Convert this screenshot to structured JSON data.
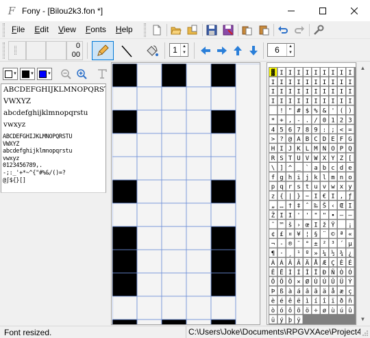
{
  "window": {
    "title": "Fony - [Bilou2k3.fon *]",
    "app_icon": "fony-f-icon"
  },
  "menu": [
    {
      "label": "File",
      "accel": "F",
      "rest": "ile"
    },
    {
      "label": "Edit",
      "accel": "E",
      "rest": "dit"
    },
    {
      "label": "View",
      "accel": "V",
      "rest": "iew"
    },
    {
      "label": "Fonts",
      "accel": "F",
      "rest": "onts"
    },
    {
      "label": "Help",
      "accel": "H",
      "rest": "elp"
    }
  ],
  "toolbar2": {
    "counter_top": "0",
    "counter_bottom": "00",
    "pen_width": "1",
    "scale": "6"
  },
  "colors": {
    "accent": "#0078d7",
    "background_swatch": "#ffffff",
    "foreground_swatch": "#000000",
    "highlight_swatch": "#0000ff",
    "pixel_on": "#000000",
    "pixel_off": "#f4f4f4",
    "grid_line": "#6c8ed8",
    "charmap_selected": "#ffff00"
  },
  "preview_large": [
    "ABCDEFGHIJKLMNOPQRSTU",
    "VWXYZ",
    "abcdefghijklmnopqrstu",
    "vwxyz"
  ],
  "preview_small": [
    "ABCDEFGHIJKLMNOPQRSTU",
    "VWXYZ",
    "abcdefghijklmnopqrstu",
    "vwxyz",
    "0123456789,.",
    "-;:_'+*~^{\"#%&/()=?",
    "@∫${}[]"
  ],
  "glyph": {
    "rows": [
      [
        1,
        0,
        1,
        0,
        1
      ],
      [
        0,
        0,
        0,
        0,
        0
      ],
      [
        1,
        0,
        0,
        0,
        1
      ],
      [
        0,
        0,
        0,
        0,
        0
      ],
      [
        0,
        0,
        0,
        0,
        0
      ],
      [
        1,
        0,
        0,
        0,
        1
      ],
      [
        0,
        0,
        0,
        0,
        0
      ],
      [
        1,
        0,
        0,
        0,
        1
      ],
      [
        1,
        0,
        0,
        0,
        1
      ],
      [
        1,
        0,
        0,
        0,
        1
      ],
      [
        0,
        0,
        0,
        0,
        0
      ],
      [
        1,
        0,
        1,
        0,
        1
      ]
    ]
  },
  "charmap": {
    "columns": 10,
    "rows": [
      [
        "▓",
        "I",
        "I",
        "I",
        "I",
        "I",
        "I",
        "I",
        "I",
        "I"
      ],
      [
        "I",
        "I",
        "I",
        "I",
        "I",
        "I",
        "I",
        "I",
        "I",
        "I"
      ],
      [
        "I",
        "I",
        "I",
        "I",
        "I",
        "I",
        "I",
        "I",
        "I",
        "I"
      ],
      [
        "I",
        "I",
        "I",
        "I",
        "I",
        "I",
        "I",
        "I",
        "I",
        "I"
      ],
      [
        " ",
        "!",
        "\"",
        "#",
        "$",
        "%",
        "&",
        "'",
        "(",
        ")"
      ],
      [
        "*",
        "+",
        ",",
        "-",
        ".",
        "/",
        "0",
        "1",
        "2",
        "3"
      ],
      [
        "4",
        "5",
        "6",
        "7",
        "8",
        "9",
        ":",
        ";",
        "<",
        "="
      ],
      [
        ">",
        "?",
        "@",
        "A",
        "B",
        "C",
        "D",
        "E",
        "F",
        "G"
      ],
      [
        "H",
        "I",
        "J",
        "K",
        "L",
        "M",
        "N",
        "O",
        "P",
        "Q"
      ],
      [
        "R",
        "S",
        "T",
        "U",
        "V",
        "W",
        "X",
        "Y",
        "Z",
        "["
      ],
      [
        "\\",
        "]",
        "^",
        "_",
        "`",
        "a",
        "b",
        "c",
        "d",
        "e"
      ],
      [
        "f",
        "g",
        "h",
        "i",
        "j",
        "k",
        "l",
        "m",
        "n",
        "o"
      ],
      [
        "p",
        "q",
        "r",
        "s",
        "t",
        "u",
        "v",
        "w",
        "x",
        "y"
      ],
      [
        "z",
        "{",
        "|",
        "}",
        "~",
        "I",
        "€",
        "I",
        "‚",
        "ƒ"
      ],
      [
        "„",
        "…",
        "†",
        "‡",
        "ˆ",
        "‰",
        "Š",
        "‹",
        "Œ",
        "I"
      ],
      [
        "Ž",
        "I",
        "I",
        "'",
        "'",
        "\"",
        "\"",
        "•",
        "–",
        "—"
      ],
      [
        "˜",
        "™",
        "š",
        "›",
        "œ",
        "I",
        "ž",
        "Ÿ",
        " ",
        "¡"
      ],
      [
        "¢",
        "£",
        "¤",
        "¥",
        "¦",
        "§",
        "¨",
        "©",
        "ª",
        "«"
      ],
      [
        "¬",
        "-",
        "®",
        "¯",
        "°",
        "±",
        "²",
        "³",
        "´",
        "µ"
      ],
      [
        "¶",
        "·",
        "¸",
        "¹",
        "º",
        "»",
        "¼",
        "½",
        "¾",
        "¿"
      ],
      [
        "À",
        "Á",
        "Â",
        "Ã",
        "Ä",
        "Å",
        "Æ",
        "Ç",
        "È",
        "É"
      ],
      [
        "Ê",
        "Ë",
        "Ì",
        "Í",
        "Î",
        "Ï",
        "Ð",
        "Ñ",
        "Ò",
        "Ó"
      ],
      [
        "Ô",
        "Õ",
        "Ö",
        "×",
        "Ø",
        "Ù",
        "Ú",
        "Û",
        "Ü",
        "Ý"
      ],
      [
        "Þ",
        "ß",
        "à",
        "á",
        "â",
        "ã",
        "ä",
        "å",
        "æ",
        "ç"
      ],
      [
        "è",
        "é",
        "ê",
        "ë",
        "ì",
        "í",
        "î",
        "ï",
        "ð",
        "ñ"
      ],
      [
        "ò",
        "ó",
        "ô",
        "õ",
        "ö",
        "÷",
        "ø",
        "ù",
        "ú",
        "û"
      ],
      [
        "ü",
        "ý",
        "þ",
        "ÿ"
      ]
    ]
  },
  "status": {
    "message": "Font resized.",
    "path": "C:\\Users\\Joke\\Documents\\RPGVXAce\\Project4\\"
  }
}
